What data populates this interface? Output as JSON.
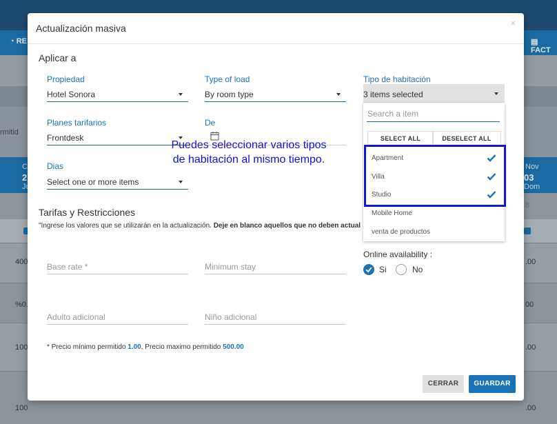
{
  "background": {
    "nav_left": "RE",
    "nav_right": "FACT",
    "left_label": "rmitid",
    "cells_left": [
      "400",
      "%0.",
      "100",
      "100"
    ],
    "cells_right": [
      ".00",
      "00",
      ".00",
      ".00"
    ],
    "right_header": {
      "month": "Nov",
      "day": "03",
      "dow": "Dom"
    },
    "right_number": "8",
    "left_col_top": "C",
    "left_col_num": "2",
    "left_col_bottom": "Ju"
  },
  "modal": {
    "title": "Actualización masiva",
    "close": "×",
    "apply_section": "Aplicar a",
    "property": {
      "label": "Propiedad",
      "value": "Hotel Sonora"
    },
    "type_of_load": {
      "label": "Type of load",
      "value": "By room type"
    },
    "room_type": {
      "label": "Tipo de habitación",
      "value": "3 items selected",
      "search_placeholder": "Search a item",
      "select_all": "SELECT ALL",
      "deselect_all": "DESELECT ALL",
      "items": [
        {
          "label": "Apartment",
          "checked": true
        },
        {
          "label": "Villa",
          "checked": true
        },
        {
          "label": "Studio",
          "checked": true
        },
        {
          "label": "Mobile Home",
          "checked": false
        },
        {
          "label": "venta de productos",
          "checked": false
        }
      ]
    },
    "rate_plans": {
      "label": "Planes tarifarios",
      "value": "Frontdesk"
    },
    "from": {
      "label": "De"
    },
    "days": {
      "label": "Dias",
      "value": "Select one or more items"
    },
    "rates_section": "Tarifas y Restricciones",
    "instruction_part1": "\"Ingrese los valores que se utilizarán en la actualización. ",
    "instruction_part2": "Deje en blanco aquellos que no deben actual",
    "base_rate": {
      "placeholder": "Base rate *"
    },
    "min_stay": {
      "placeholder": "Minimum stay"
    },
    "adult_extra": {
      "placeholder": "Adulto adicional"
    },
    "child_extra": {
      "placeholder": "Niño adicional"
    },
    "online_availability": {
      "label": "Online availability :",
      "yes": "Si",
      "no": "No",
      "selected": "Si"
    },
    "price_note_prefix": "* Precio mínimo permitido ",
    "price_min": "1.00",
    "price_note_middle": ", Precio maximo permitido ",
    "price_max": "500.00",
    "cancel": "CERRAR",
    "save": "GUARDAR"
  },
  "annotation": {
    "line1": "Puedes seleccionar varios tipos",
    "line2": "de habitación al mismo tiempo."
  },
  "colors": {
    "accent": "#1a73b7",
    "annotation": "#1010e0"
  }
}
